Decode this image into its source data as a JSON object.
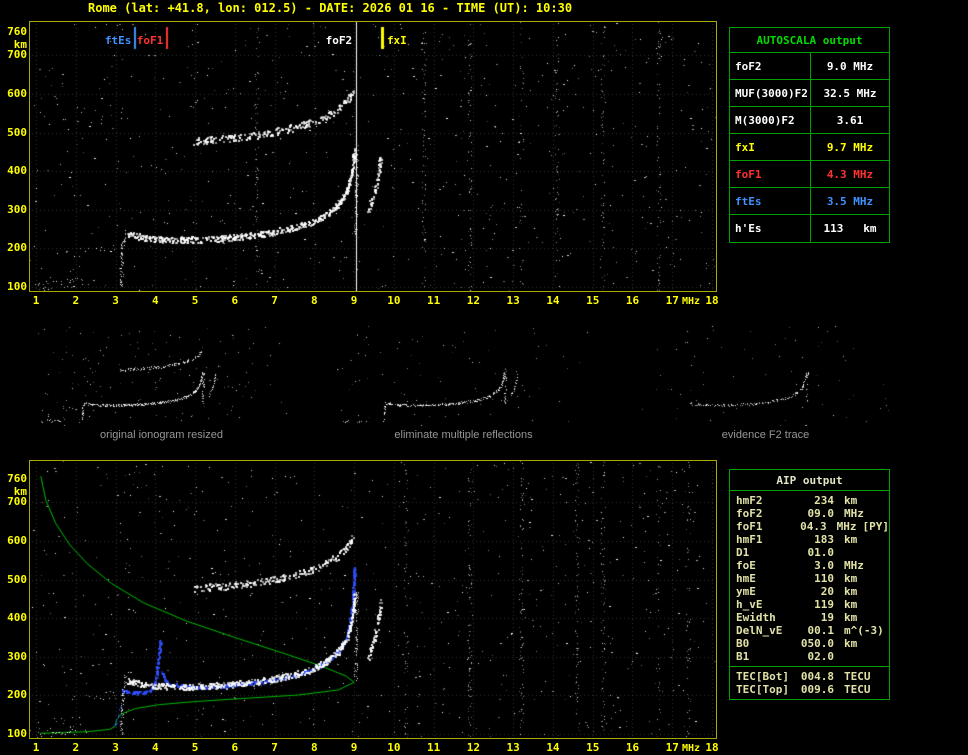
{
  "title": "Rome (lat: +41.8, lon: 012.5) - DATE: 2026 01 16 - TIME (UT): 10:30",
  "colors": {
    "background": "#000000",
    "axis_text": "#ffff00",
    "panel_border": "#a8a800",
    "table_border": "#00a000",
    "table_header_green": "#00dd00",
    "trace_white": "#ffffff",
    "profile_green": "#00bb00",
    "model_blue": "#3050ff",
    "fxI_yellow": "#ffff00",
    "foF1_red": "#ff3232",
    "ftEs_blue": "#4092ff",
    "caption_gray": "#969696",
    "aip_text": "#e2e2a8"
  },
  "axes": {
    "y_unit": "km",
    "x_unit": "MHz",
    "y_ticks": [
      760,
      700,
      600,
      500,
      400,
      300,
      200,
      100
    ],
    "x_ticks": [
      1,
      2,
      3,
      4,
      5,
      6,
      7,
      8,
      9,
      10,
      11,
      12,
      13,
      14,
      15,
      16,
      17,
      18
    ]
  },
  "autoscala_table": {
    "title": "AUTOSCALA output",
    "rows": [
      {
        "label": "foF2",
        "value": "9.0 MHz",
        "color": "#ffffff"
      },
      {
        "label": "MUF(3000)F2",
        "value": "32.5 MHz",
        "color": "#ffffff"
      },
      {
        "label": "M(3000)F2",
        "value": "3.61",
        "color": "#ffffff"
      },
      {
        "label": "fxI",
        "value": "9.7 MHz",
        "color": "#ffff00"
      },
      {
        "label": "foF1",
        "value": "4.3 MHz",
        "color": "#ff3232"
      },
      {
        "label": "ftEs",
        "value": "3.5 MHz",
        "color": "#4092ff"
      },
      {
        "label": "h'Es",
        "value": "113   km",
        "color": "#ffffff"
      }
    ]
  },
  "thumbnails": [
    {
      "caption": "original ionogram resized",
      "trace_ids": [
        "es_low",
        "es_patch",
        "es_step",
        "cusp",
        "f1f2",
        "f2_asym",
        "hop2",
        "xmode"
      ],
      "density_scale": 0.5,
      "noise": 150,
      "seed": 21
    },
    {
      "caption": "eliminate multiple reflections",
      "trace_ids": [
        "es_low",
        "cusp",
        "f1f2",
        "f2_asym",
        "xmode"
      ],
      "density_scale": 0.4,
      "noise": 90,
      "seed": 22
    },
    {
      "caption": "evidence F2 trace",
      "trace_ids": [
        "f1f2",
        "f2_asym"
      ],
      "density_scale": 0.22,
      "noise": 70,
      "seed": 23
    }
  ],
  "aip_table": {
    "title": "AIP output",
    "rows": [
      {
        "name": "hmF2",
        "value": "234",
        "unit": "km",
        "extra": ""
      },
      {
        "name": "foF2",
        "value": "09.0",
        "unit": "MHz",
        "extra": ""
      },
      {
        "name": "foF1",
        "value": "04.3",
        "unit": "MHz",
        "extra": "[PY]"
      },
      {
        "name": "hmF1",
        "value": "183",
        "unit": "km",
        "extra": ""
      },
      {
        "name": "D1",
        "value": "01.0",
        "unit": "",
        "extra": ""
      },
      {
        "name": "foE",
        "value": "3.0",
        "unit": "MHz",
        "extra": ""
      },
      {
        "name": "hmE",
        "value": "110",
        "unit": "km",
        "extra": ""
      },
      {
        "name": "ymE",
        "value": "20",
        "unit": "km",
        "extra": ""
      },
      {
        "name": "h_vE",
        "value": "119",
        "unit": "km",
        "extra": ""
      },
      {
        "name": "Ewidth",
        "value": "19",
        "unit": "km",
        "extra": ""
      },
      {
        "name": "DelN_vE",
        "value": "00.1",
        "unit": "m^(-3)",
        "extra": ""
      },
      {
        "name": "B0",
        "value": "050.0",
        "unit": "km",
        "extra": ""
      },
      {
        "name": "B1",
        "value": "02.0",
        "unit": "",
        "extra": ""
      }
    ],
    "tec_rows": [
      {
        "name": "TEC[Bot]",
        "value": "004.8",
        "unit": "TECU"
      },
      {
        "name": "TEC[Top]",
        "value": "009.6",
        "unit": "TECU"
      }
    ]
  },
  "chart_data": [
    {
      "id": "top_ionogram",
      "type": "scatter",
      "title": "measured ionogram with AUTOSCALA scaled characteristics",
      "xlabel": "MHz",
      "ylabel": "km",
      "xlim": [
        1,
        18
      ],
      "ylim": [
        100,
        760
      ],
      "grid": true,
      "scaled_values": {
        "foF2_MHz": 9.0,
        "MUF3000F2_MHz": 32.5,
        "M3000F2": 3.61,
        "fxI_MHz": 9.7,
        "foF1_MHz": 4.3,
        "ftEs_MHz": 3.5,
        "hEs_km": 113
      },
      "markers": [
        {
          "label": "ftEs",
          "f_mhz": 3.5,
          "color": "#4092ff",
          "tick": "short",
          "label_side": "left"
        },
        {
          "label": "foF1",
          "f_mhz": 4.3,
          "color": "#ff3232",
          "tick": "short",
          "label_side": "left"
        },
        {
          "label": "foF2",
          "f_mhz": 9.05,
          "color": "#ffffff",
          "tick": "full",
          "label_side": "left"
        },
        {
          "label": "fxI",
          "f_mhz": 9.7,
          "color": "#ffff00",
          "tick": "short",
          "label_side": "right"
        }
      ],
      "noise_columns_mhz": [
        6.55,
        10.75,
        11.9,
        13.2,
        14.1,
        15.25,
        16.65
      ],
      "noise_dots": 650,
      "traces": [
        {
          "id": "es_low",
          "color": "#ffffff",
          "density": 0.5,
          "size": 1,
          "jx": 4,
          "jy_km": 26,
          "points_f_km": [
            [
              1.0,
              107
            ],
            [
              1.7,
              110
            ],
            [
              2.3,
              114
            ]
          ]
        },
        {
          "id": "es_patch",
          "color": "#ffffff",
          "density": 0.18,
          "size": 1,
          "jx": 6,
          "jy_km": 90,
          "points_f_km": [
            [
              1.1,
              150
            ],
            [
              2.05,
              160
            ]
          ]
        },
        {
          "id": "es_step",
          "color": "#ffffff",
          "density": 0.22,
          "size": 1,
          "jx": 4,
          "jy_km": 20,
          "points_f_km": [
            [
              2.1,
              196
            ],
            [
              3.05,
              203
            ]
          ]
        },
        {
          "id": "cusp",
          "color": "#ffffff",
          "density": 1.0,
          "size": 1,
          "jx": 3,
          "jy_km": 14,
          "points_f_km": [
            [
              3.13,
              102
            ],
            [
              3.17,
              200
            ],
            [
              3.24,
              252
            ]
          ]
        },
        {
          "id": "f1f2",
          "color": "#ffffff",
          "density": 1.9,
          "size": 2,
          "jx": 2,
          "jy_km": 16,
          "points_f_km": [
            [
              3.28,
              238
            ],
            [
              3.8,
              227
            ],
            [
              4.5,
              223
            ],
            [
              5.2,
              224
            ],
            [
              5.9,
              229
            ],
            [
              6.6,
              237
            ],
            [
              7.2,
              248
            ],
            [
              7.8,
              263
            ],
            [
              8.25,
              285
            ],
            [
              8.6,
              317
            ],
            [
              8.82,
              352
            ],
            [
              8.95,
              405
            ],
            [
              9.0,
              460
            ]
          ]
        },
        {
          "id": "f2_asym",
          "color": "#ffffff",
          "density": 0.9,
          "size": 1,
          "jx": 3,
          "jy_km": 10,
          "points_f_km": [
            [
              9.03,
              240
            ],
            [
              9.07,
              470
            ]
          ]
        },
        {
          "id": "hop2",
          "color": "#ffffff",
          "density": 1.2,
          "size": 2,
          "jx": 2,
          "jy_km": 18,
          "points_f_km": [
            [
              4.95,
              478
            ],
            [
              5.7,
              484
            ],
            [
              6.4,
              493
            ],
            [
              7.05,
              504
            ],
            [
              7.65,
              518
            ],
            [
              8.15,
              536
            ],
            [
              8.55,
              560
            ],
            [
              8.85,
              590
            ],
            [
              8.97,
              615
            ]
          ]
        },
        {
          "id": "xmode",
          "color": "#ffffff",
          "density": 1.0,
          "size": 2,
          "jx": 3,
          "jy_km": 16,
          "points_f_km": [
            [
              9.32,
              295
            ],
            [
              9.47,
              335
            ],
            [
              9.58,
              385
            ],
            [
              9.66,
              445
            ]
          ]
        }
      ]
    },
    {
      "id": "bottom_ionogram",
      "type": "scatter",
      "title": "ionogram with AIP restored trace and electron density profile",
      "xlabel": "MHz",
      "ylabel": "km",
      "xlim": [
        1,
        18
      ],
      "ylim": [
        100,
        760
      ],
      "grid": true,
      "include_traces_from": "top_ionogram",
      "noise_columns_mhz": [
        10.3,
        11.9,
        13.2,
        14.6,
        15.25,
        16.65,
        17.4
      ],
      "noise_dots": 650,
      "curves": [
        {
          "id": "density_profile",
          "color": "#00bb00",
          "width": 1,
          "points_f_km": [
            [
              1.12,
              768
            ],
            [
              1.25,
              705
            ],
            [
              1.5,
              645
            ],
            [
              1.85,
              590
            ],
            [
              2.3,
              540
            ],
            [
              2.9,
              490
            ],
            [
              3.7,
              440
            ],
            [
              4.8,
              392
            ],
            [
              6.0,
              350
            ],
            [
              7.2,
              310
            ],
            [
              8.2,
              275
            ],
            [
              8.8,
              250
            ],
            [
              9.0,
              234
            ],
            [
              8.6,
              214
            ],
            [
              7.6,
              201
            ],
            [
              6.2,
              192
            ],
            [
              5.0,
              184
            ],
            [
              4.1,
              176
            ],
            [
              3.5,
              166
            ],
            [
              3.15,
              152
            ],
            [
              3.02,
              136
            ],
            [
              3.0,
              120
            ],
            [
              2.85,
              112
            ],
            [
              2.3,
              106
            ],
            [
              1.5,
              103
            ],
            [
              1.1,
              102
            ]
          ]
        }
      ],
      "traces": [
        {
          "id": "blue_spike",
          "color": "#3050ff",
          "density": 1.6,
          "size": 2,
          "jx": 2,
          "jy_km": 8,
          "points_f_km": [
            [
              3.15,
              213
            ],
            [
              3.5,
              208
            ],
            [
              3.85,
              212
            ],
            [
              4.0,
              238
            ],
            [
              4.07,
              295
            ],
            [
              4.12,
              345
            ]
          ]
        },
        {
          "id": "blue_main",
          "color": "#3050ff",
          "density": 1.6,
          "size": 2,
          "jx": 2,
          "jy_km": 8,
          "points_f_km": [
            [
              4.16,
              262
            ],
            [
              4.3,
              230
            ],
            [
              5.0,
              222
            ],
            [
              5.9,
              227
            ],
            [
              6.6,
              235
            ],
            [
              7.2,
              246
            ],
            [
              7.8,
              261
            ],
            [
              8.25,
              283
            ],
            [
              8.6,
              315
            ],
            [
              8.8,
              350
            ],
            [
              8.9,
              395
            ],
            [
              8.97,
              465
            ],
            [
              9.0,
              535
            ]
          ]
        },
        {
          "id": "blue_e",
          "color": "#3050ff",
          "density": 0.9,
          "size": 1,
          "jx": 2,
          "jy_km": 10,
          "points_f_km": [
            [
              2.95,
              118
            ],
            [
              3.05,
              142
            ],
            [
              3.12,
              178
            ]
          ]
        }
      ]
    }
  ]
}
